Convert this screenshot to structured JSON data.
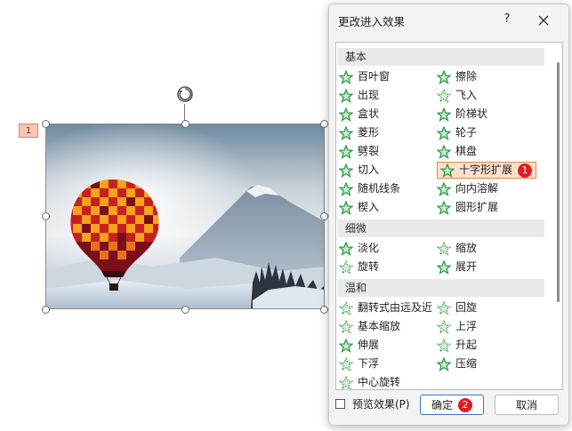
{
  "slide": {
    "index_label": "1",
    "picture_icon": "hot-air-balloon-photo",
    "rotate_icon": "rotate-handle-icon"
  },
  "dialog": {
    "title": "更改进入效果",
    "help_label": "?",
    "close_icon": "close-icon",
    "sections": [
      {
        "name": "基本",
        "items": [
          {
            "label": "百叶窗",
            "style": "green-star"
          },
          {
            "label": "擦除",
            "style": "green-star"
          },
          {
            "label": "出现",
            "style": "green-star"
          },
          {
            "label": "飞入",
            "style": "faded-star"
          },
          {
            "label": "盒状",
            "style": "green-star"
          },
          {
            "label": "阶梯状",
            "style": "green-star"
          },
          {
            "label": "菱形",
            "style": "green-star"
          },
          {
            "label": "轮子",
            "style": "green-star"
          },
          {
            "label": "劈裂",
            "style": "green-star"
          },
          {
            "label": "棋盘",
            "style": "green-star"
          },
          {
            "label": "切入",
            "style": "green-star"
          },
          {
            "label": "十字形扩展",
            "style": "green-star",
            "selected": true,
            "badge": "1"
          },
          {
            "label": "随机线条",
            "style": "green-star"
          },
          {
            "label": "向内溶解",
            "style": "green-star"
          },
          {
            "label": "楔入",
            "style": "green-star"
          },
          {
            "label": "圆形扩展",
            "style": "green-star"
          }
        ]
      },
      {
        "name": "细微",
        "items": [
          {
            "label": "淡化",
            "style": "green-star"
          },
          {
            "label": "缩放",
            "style": "faded-star"
          },
          {
            "label": "旋转",
            "style": "faded-star"
          },
          {
            "label": "展开",
            "style": "green-star"
          }
        ]
      },
      {
        "name": "温和",
        "items": [
          {
            "label": "翻转式由远及近",
            "style": "faded-star"
          },
          {
            "label": "回旋",
            "style": "faded-star"
          },
          {
            "label": "基本缩放",
            "style": "faded-star"
          },
          {
            "label": "上浮",
            "style": "faded-star"
          },
          {
            "label": "伸展",
            "style": "green-star"
          },
          {
            "label": "升起",
            "style": "faded-star"
          },
          {
            "label": "下浮",
            "style": "faded-star"
          },
          {
            "label": "压缩",
            "style": "green-star"
          },
          {
            "label": "中心旋转",
            "style": "faded-star"
          }
        ]
      }
    ],
    "preview_label": "预览效果(P)",
    "preview_checked": false,
    "ok_label": "确定",
    "ok_badge": "2",
    "cancel_label": "取消"
  },
  "colors": {
    "star_green": "#2e9b45",
    "selection_fill": "#fde0cc",
    "selection_border": "#e3893f",
    "badge_red": "#e01b24",
    "ok_border": "#3b76c8"
  }
}
